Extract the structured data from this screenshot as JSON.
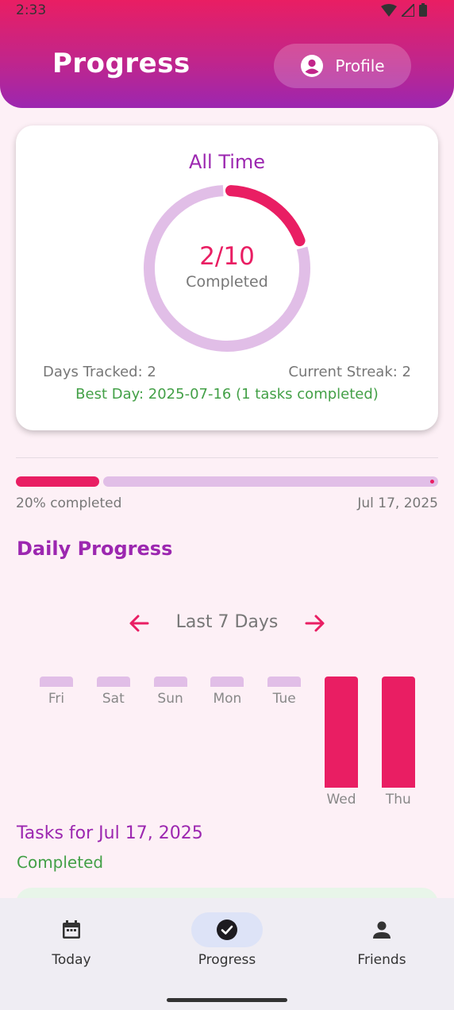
{
  "status_bar": {
    "time": "2:33"
  },
  "header": {
    "title": "Progress",
    "profile_label": "Profile"
  },
  "summary": {
    "title": "All Time",
    "completed_text": "2/10",
    "completed_label": "Completed",
    "progress_fraction": 0.2,
    "days_tracked": "Days Tracked: 2",
    "current_streak": "Current Streak: 2",
    "best_day": "Best Day: 2025-07-16 (1 tasks completed)"
  },
  "overall_bar": {
    "percent": 20,
    "percent_label": "20% completed",
    "date_label": "Jul 17, 2025"
  },
  "daily": {
    "title": "Daily Progress",
    "range_label": "Last 7 Days",
    "days": [
      {
        "label": "Fri",
        "value": 0
      },
      {
        "label": "Sat",
        "value": 0
      },
      {
        "label": "Sun",
        "value": 0
      },
      {
        "label": "Mon",
        "value": 0
      },
      {
        "label": "Tue",
        "value": 0
      },
      {
        "label": "Wed",
        "value": 1
      },
      {
        "label": "Thu",
        "value": 1
      }
    ]
  },
  "tasks": {
    "title": "Tasks for Jul 17, 2025",
    "completed_heading": "Completed"
  },
  "bottom_nav": {
    "items": [
      {
        "label": "Today",
        "icon": "calendar-icon"
      },
      {
        "label": "Progress",
        "icon": "check-circle-icon",
        "active": true
      },
      {
        "label": "Friends",
        "icon": "person-icon"
      }
    ]
  },
  "colors": {
    "primary": "#e91e63",
    "accent": "#9c27b0",
    "track": "#e1bee7",
    "success": "#43a047"
  }
}
